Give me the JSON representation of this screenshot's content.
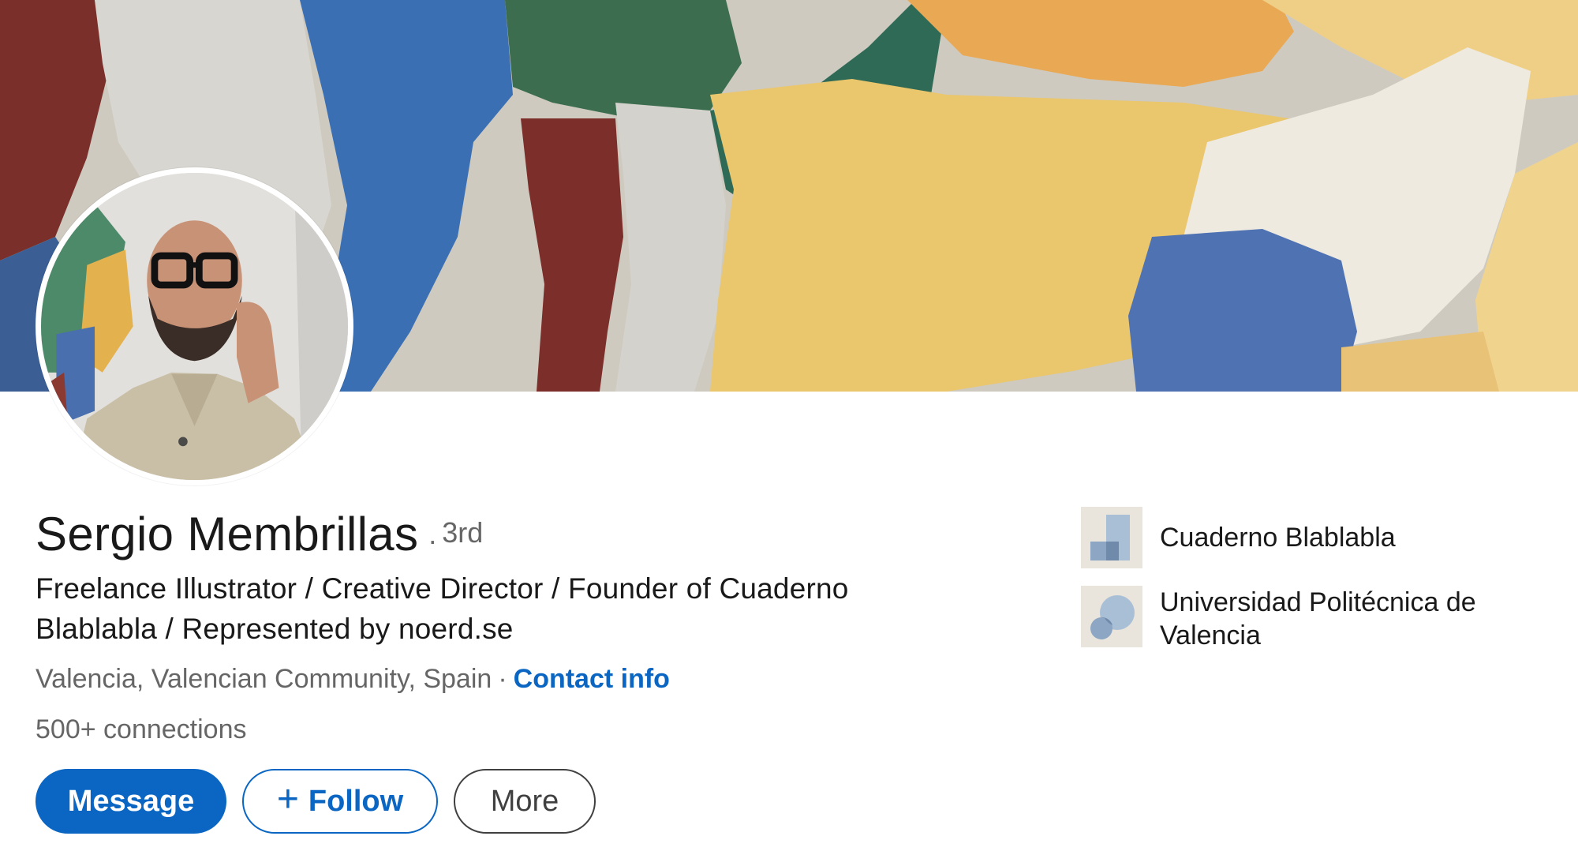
{
  "profile": {
    "name": "Sergio Membrillas",
    "degree_separator": "·",
    "degree": "3rd",
    "headline": "Freelance Illustrator / Creative Director / Founder of Cuaderno Blablabla / Represented by noerd.se",
    "location": "Valencia, Valencian Community, Spain",
    "location_separator": "·",
    "contact_info_label": "Contact info",
    "connections": "500+ connections"
  },
  "actions": {
    "message_label": "Message",
    "follow_icon": "+",
    "follow_label": "Follow",
    "more_label": "More"
  },
  "organizations": [
    {
      "name": "Cuaderno Blablabla",
      "icon": "company-logo-icon"
    },
    {
      "name": "Universidad Politécnica de Valencia",
      "icon": "school-logo-icon"
    }
  ],
  "colors": {
    "accent": "#0a66c2",
    "text_primary": "#191919",
    "text_secondary": "#666666",
    "outline_dark": "#404040"
  },
  "images": {
    "banner": "abstract-painting-banner",
    "avatar": "profile-photo-avatar"
  }
}
